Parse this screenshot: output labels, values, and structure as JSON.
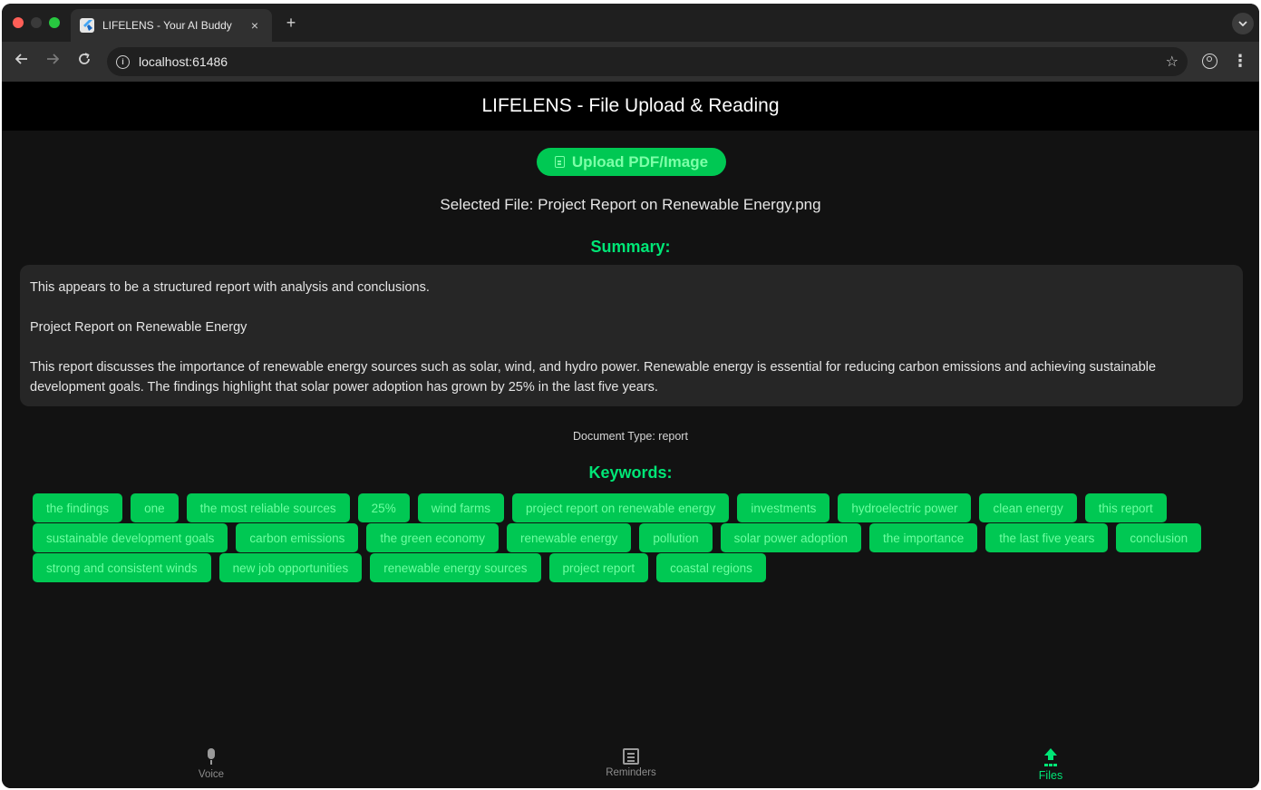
{
  "browser": {
    "tab_title": "LIFELENS - Your AI Buddy",
    "tab_close": "×",
    "new_tab": "+",
    "url": "localhost:61486",
    "icons": [
      "back-icon",
      "forward-icon",
      "reload-icon",
      "info-icon",
      "star-icon",
      "profile-icon",
      "menu-icon"
    ]
  },
  "app": {
    "title": "LIFELENS - File Upload & Reading",
    "upload_label": "Upload PDF/Image",
    "selected_file": "Selected File: Project Report on Renewable Energy.png",
    "summary_heading": "Summary:",
    "summary": [
      "This appears to be a structured report with analysis and conclusions.",
      "Project Report on Renewable Energy",
      "This report discusses the importance of renewable energy sources such as solar, wind, and hydro power. Renewable energy is essential for reducing carbon emissions and achieving sustainable development goals. The findings highlight that solar power adoption has grown by 25% in the last five years."
    ],
    "document_type": "Document Type: report",
    "keywords_heading": "Keywords:",
    "keywords": [
      "the findings",
      "one",
      "the most reliable sources",
      "25%",
      "wind farms",
      "project report on renewable energy",
      "investments",
      "hydroelectric power",
      "clean energy",
      "this report",
      "sustainable development goals",
      "carbon emissions",
      "the green economy",
      "renewable energy",
      "pollution",
      "solar power adoption",
      "the importance",
      "the last five years",
      "conclusion",
      "strong and consistent winds",
      "new job opportunities",
      "renewable energy sources",
      "project report",
      "coastal regions"
    ]
  },
  "bottom_nav": [
    {
      "label": "Voice",
      "icon": "mic-icon",
      "active": false
    },
    {
      "label": "Reminders",
      "icon": "list-icon",
      "active": false
    },
    {
      "label": "Files",
      "icon": "upload-icon",
      "active": true
    }
  ],
  "colors": {
    "accent": "#00c853",
    "accent_text": "#00e676",
    "background": "#121212",
    "card": "#262626"
  }
}
